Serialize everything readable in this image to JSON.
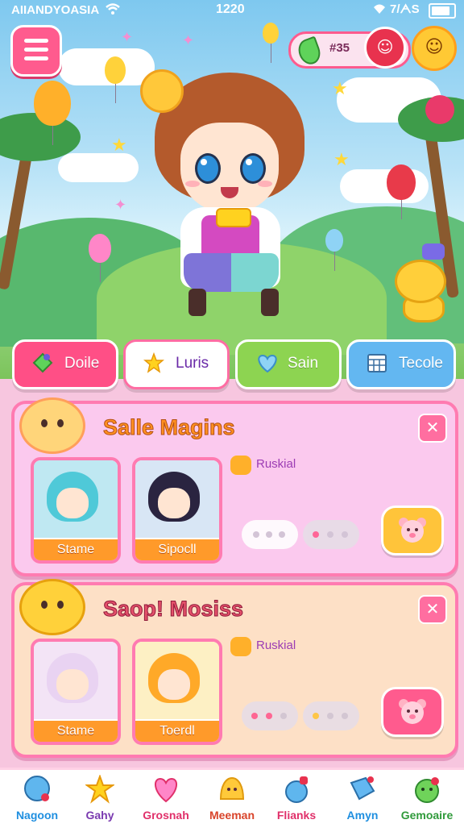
{
  "status_bar": {
    "carrier": "AIIANDYOASIA",
    "time": "1220",
    "right": "7/ᗅS"
  },
  "currency": {
    "value": "#35"
  },
  "tabs": [
    {
      "label": "Doile",
      "icon": "gem-icon"
    },
    {
      "label": "Luris",
      "icon": "star-icon"
    },
    {
      "label": "Sain",
      "icon": "heart-icon"
    },
    {
      "label": "Tecole",
      "icon": "calendar-icon"
    }
  ],
  "cards": [
    {
      "title": "Salle Magins",
      "tag": "Ruskial",
      "characters": [
        {
          "name": "Stame"
        },
        {
          "name": "Sipocll"
        }
      ]
    },
    {
      "title": "Saop! Mosiss",
      "tag": "Ruskial",
      "characters": [
        {
          "name": "Stame"
        },
        {
          "name": "Toerdl"
        }
      ]
    }
  ],
  "nav": [
    {
      "label": "Nagoon",
      "color": "#1f8fe0"
    },
    {
      "label": "Gahy",
      "color": "#7a3ab0"
    },
    {
      "label": "Grosnah",
      "color": "#e0306a"
    },
    {
      "label": "Meeman",
      "color": "#d9442a"
    },
    {
      "label": "Flianks",
      "color": "#e0306a"
    },
    {
      "label": "Amyn",
      "color": "#1f8fe0"
    },
    {
      "label": "Gemoaire",
      "color": "#2f9a3a"
    }
  ]
}
